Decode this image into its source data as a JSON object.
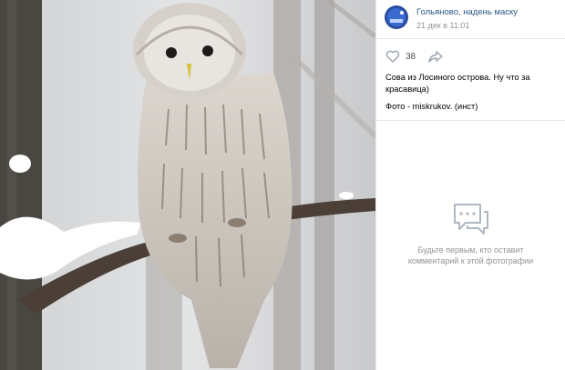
{
  "post": {
    "author": "Гольяново, надень маску",
    "date": "21 дек в 11:01",
    "likes": "38",
    "caption_line": "Сова из Лосиного острова. Ну что за красавица)",
    "credit_line": "Фото - miskrukov. (инст)"
  },
  "comments": {
    "empty_message": "Будьте первым, кто оставит комментарий к этой фотографии"
  },
  "icons": {
    "like": "heart-icon",
    "share": "share-arrow-icon",
    "empty": "comments-bubble-icon"
  },
  "colors": {
    "link": "#2a5885",
    "muted": "#939393",
    "divider": "#e7e8ec",
    "icon": "#aeb7c2"
  }
}
